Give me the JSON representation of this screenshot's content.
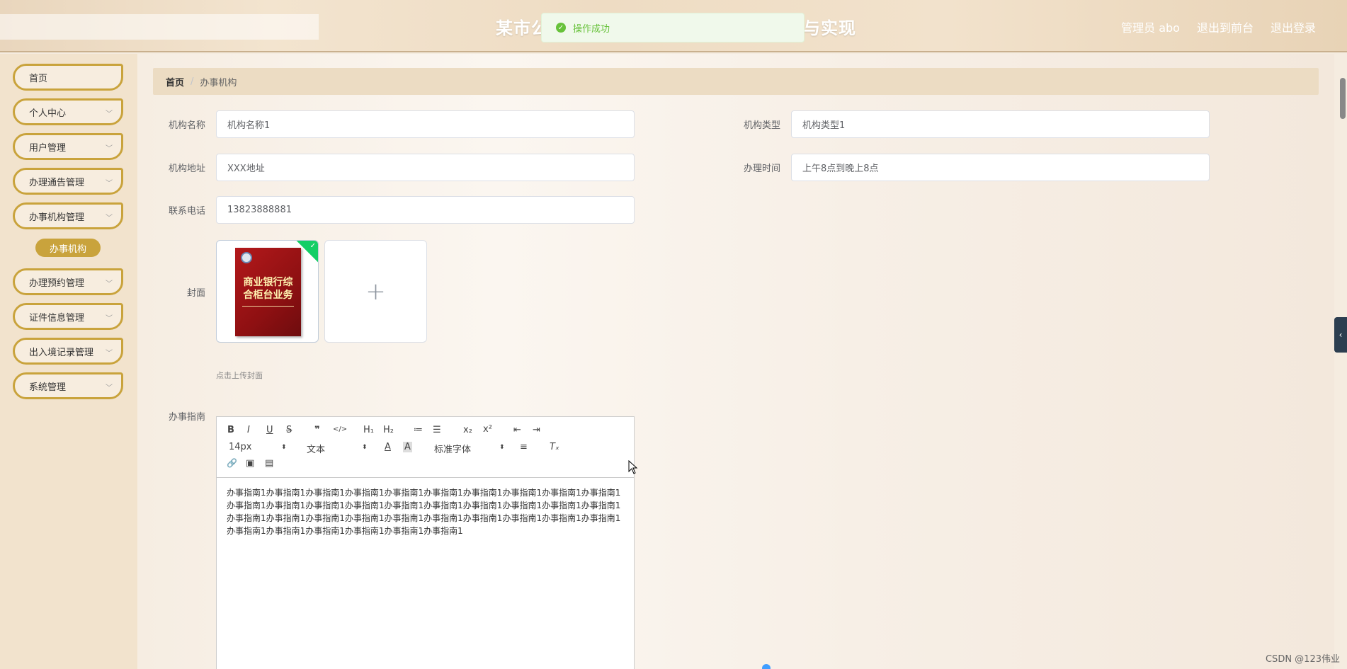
{
  "header": {
    "title_left": "某市公",
    "title_right": "与实现",
    "nav": {
      "admin": "管理员 abo",
      "back_to_front": "退出到前台",
      "logout": "退出登录"
    }
  },
  "toast": {
    "message": "操作成功"
  },
  "sidebar": {
    "items": [
      {
        "label": "首页",
        "has_children": false
      },
      {
        "label": "个人中心",
        "has_children": true
      },
      {
        "label": "用户管理",
        "has_children": true
      },
      {
        "label": "办理通告管理",
        "has_children": true
      },
      {
        "label": "办事机构管理",
        "has_children": true
      },
      {
        "label": "办理预约管理",
        "has_children": true
      },
      {
        "label": "证件信息管理",
        "has_children": true
      },
      {
        "label": "出入境记录管理",
        "has_children": true
      },
      {
        "label": "系统管理",
        "has_children": true
      }
    ],
    "active_sub": "办事机构"
  },
  "breadcrumb": {
    "home": "首页",
    "separator": "/",
    "current": "办事机构"
  },
  "form": {
    "name": {
      "label": "机构名称",
      "value": "机构名称1"
    },
    "type": {
      "label": "机构类型",
      "value": "机构类型1"
    },
    "address": {
      "label": "机构地址",
      "value": "XXX地址"
    },
    "hours": {
      "label": "办理时间",
      "value": "上午8点到晚上8点"
    },
    "phone": {
      "label": "联系电话",
      "value": "13823888881"
    },
    "cover": {
      "label": "封面",
      "tip": "点击上传封面",
      "book_title": "商业银行综合柜台业务",
      "add_symbol": "+"
    },
    "guide": {
      "label": "办事指南",
      "content": "办事指南1办事指南1办事指南1办事指南1办事指南1办事指南1办事指南1办事指南1办事指南1办事指南1办事指南1办事指南1办事指南1办事指南1办事指南1办事指南1办事指南1办事指南1办事指南1办事指南1办事指南1办事指南1办事指南1办事指南1办事指南1办事指南1办事指南1办事指南1办事指南1办事指南1办事指南1办事指南1办事指南1办事指南1办事指南1办事指南1"
    }
  },
  "editor_toolbar": {
    "bold": "B",
    "italic": "I",
    "underline": "U",
    "strike": "S",
    "quote": "❞",
    "code": "</>",
    "h1": "H₁",
    "h2": "H₂",
    "ordered": "≔",
    "bullet": "☰",
    "sub": "x₂",
    "sup": "x²",
    "outdent": "⇤",
    "indent": "⇥",
    "size": "14px",
    "format": "文本",
    "font": "标准字体",
    "color": "A",
    "bg": "A",
    "align": "≡",
    "clear": "Tₓ",
    "link": "🔗",
    "image": "▣",
    "video": "▤"
  },
  "watermark": "CSDN @123伟业",
  "side_tab_symbol": "‹"
}
